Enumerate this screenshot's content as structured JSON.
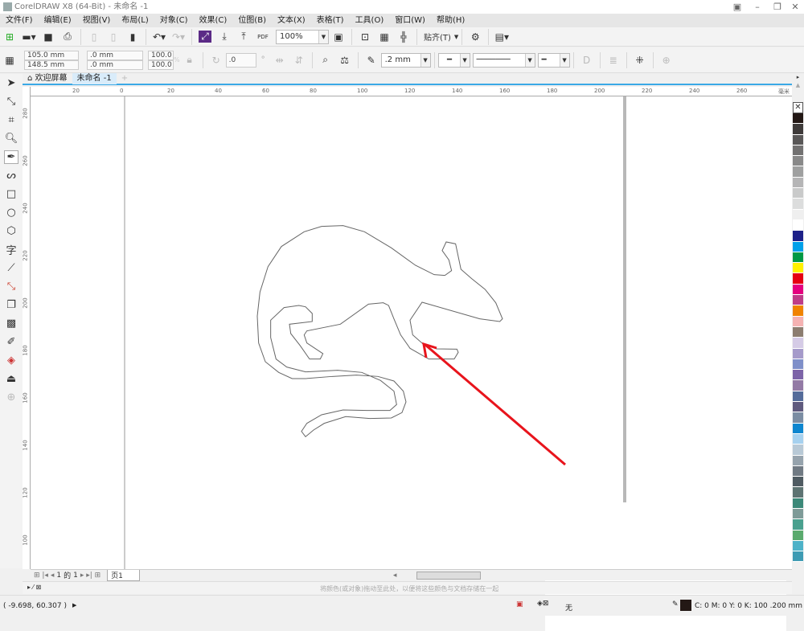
{
  "window": {
    "title": "CorelDRAW X8 (64-Bit) - 未命名 -1"
  },
  "menu": [
    "文件(F)",
    "编辑(E)",
    "视图(V)",
    "布局(L)",
    "对象(C)",
    "效果(C)",
    "位图(B)",
    "文本(X)",
    "表格(T)",
    "工具(O)",
    "窗口(W)",
    "帮助(H)"
  ],
  "toolbar": {
    "zoom": "100%",
    "snap": "贴齐(T)",
    "pdf": "PDF"
  },
  "props": {
    "x": "105.0 mm",
    "y": "148.5 mm",
    "w": ".0 mm",
    "h": ".0 mm",
    "sx": "100.0",
    "sy": "100.0",
    "pct": "%",
    "angle": ".0",
    "deg": "°",
    "outline": ".2 mm"
  },
  "tabs": [
    {
      "label": "欢迎屏幕"
    },
    {
      "label": "未命名 -1"
    }
  ],
  "rulers": {
    "h": [
      "20",
      "0",
      "20",
      "40",
      "60",
      "80",
      "100",
      "120",
      "140",
      "160",
      "180",
      "200",
      "220",
      "240",
      "260"
    ],
    "unit": "毫米",
    "v": [
      "280",
      "260",
      "240",
      "220",
      "200",
      "180",
      "160",
      "140",
      "120",
      "100"
    ]
  },
  "pagenav": {
    "current": "1",
    "of": "的",
    "total": "1",
    "page_tab": "页1"
  },
  "docpal": {
    "hint": "将颜色(或对象)拖动至此处，以便将这些颜色与文档存储在一起"
  },
  "status": {
    "coords": "( -9.698, 60.307 )",
    "fill": "无",
    "outline_info": "C: 0 M: 0 Y: 0 K: 100  .200 mm"
  },
  "colors": {
    "accent": "#3aa9e6",
    "arrow": "#e8141c",
    "outline_swatch": "#231815"
  },
  "palette": [
    "#231815",
    "#3e3a39",
    "#595757",
    "#727171",
    "#898989",
    "#9fa0a0",
    "#b5b5b6",
    "#c9caca",
    "#dcdddd",
    "#efefef",
    "#ffffff",
    "#1d2088",
    "#00a0e9",
    "#009944",
    "#fff100",
    "#e60012",
    "#e4007f",
    "#be3c88",
    "#f08300",
    "#f5b2b2",
    "#8c7d70",
    "#d5cbe6",
    "#a59aca",
    "#7f8fc9",
    "#7d64a8",
    "#937aa5",
    "#546b9a",
    "#5f5a7e",
    "#7b8da3",
    "#0e86cf",
    "#a6d1ef",
    "#b8c9d6",
    "#96a3ad",
    "#707a83",
    "#4f5b62",
    "#5d7372",
    "#3b8878",
    "#7e9b98",
    "#49a08e",
    "#5aaa6d",
    "#4db2c8",
    "#3e9bb3"
  ]
}
